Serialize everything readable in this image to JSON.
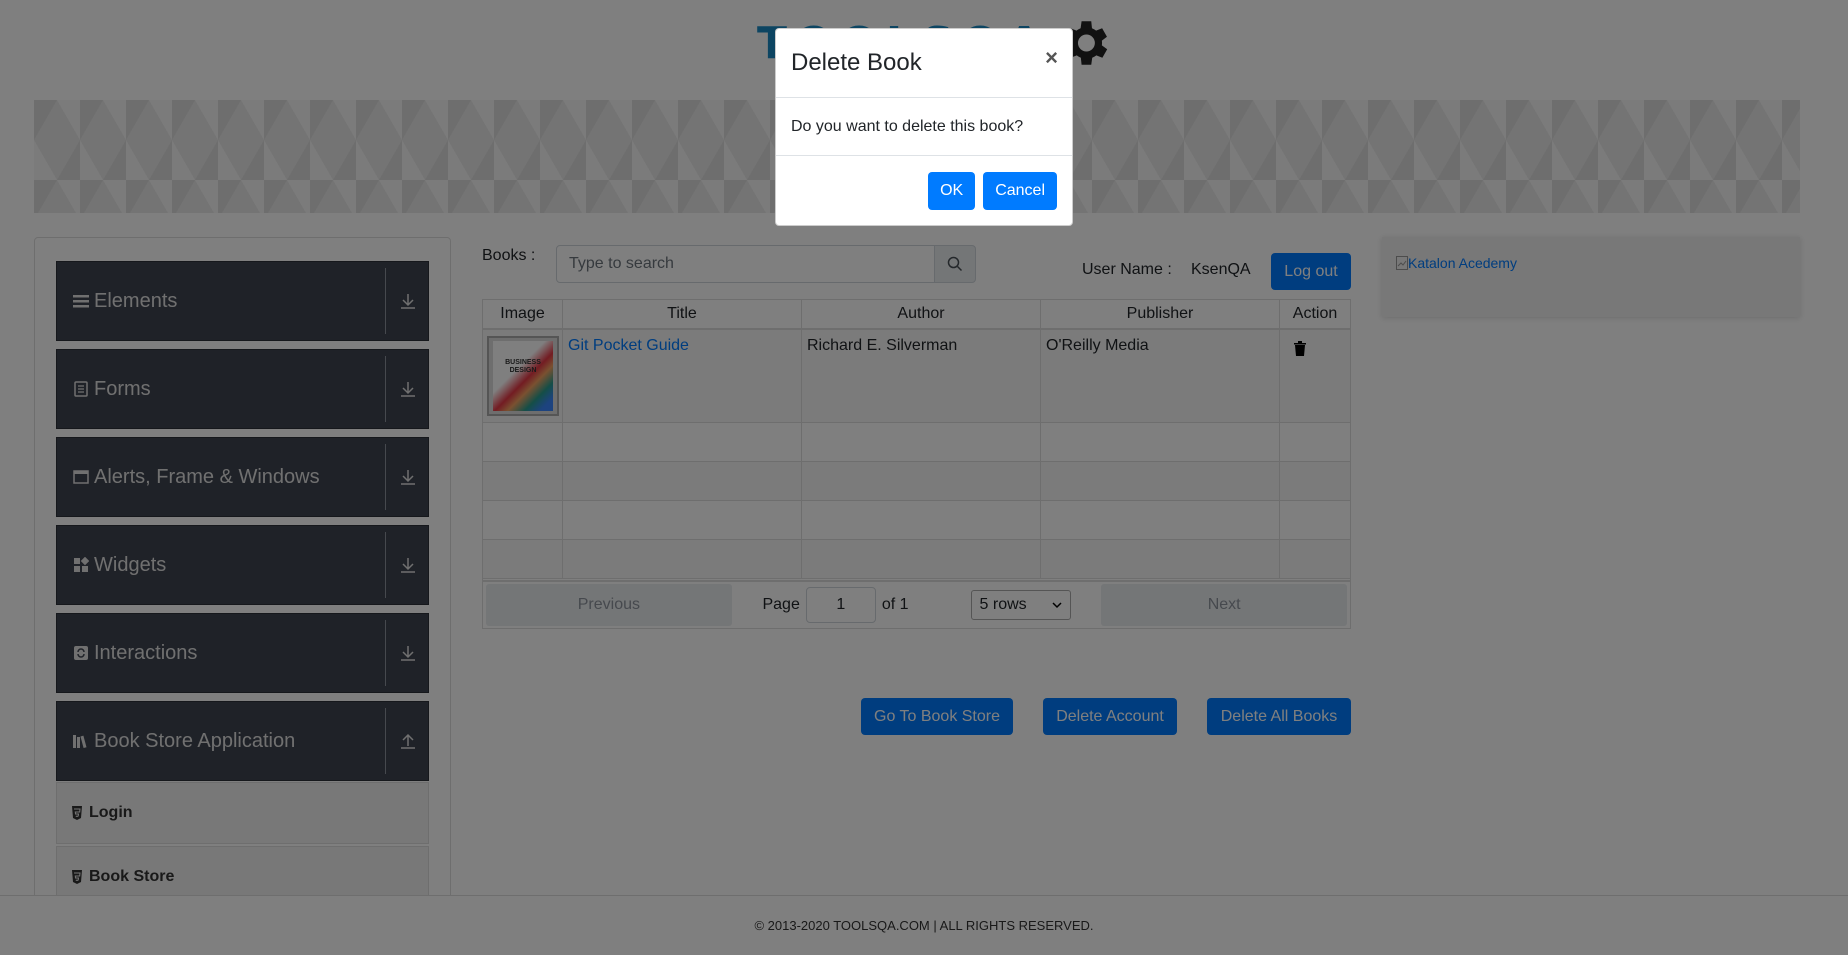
{
  "header": {
    "logo_text": "TOOLSQA"
  },
  "sidebar": {
    "groups": [
      {
        "label": "Elements",
        "icon": "menu-icon"
      },
      {
        "label": "Forms",
        "icon": "form-icon"
      },
      {
        "label": "Alerts, Frame & Windows",
        "icon": "window-icon"
      },
      {
        "label": "Widgets",
        "icon": "widgets-icon"
      },
      {
        "label": "Interactions",
        "icon": "interactions-icon"
      },
      {
        "label": "Book Store Application",
        "icon": "books-icon"
      }
    ],
    "subitems": [
      {
        "label": "Login",
        "icon": "html5-icon"
      },
      {
        "label": "Book Store",
        "icon": "html5-icon"
      }
    ]
  },
  "main": {
    "books_label": "Books :",
    "search": {
      "placeholder": "Type to search"
    },
    "user": {
      "label": "User Name :",
      "value": "KsenQA"
    },
    "logout_label": "Log out",
    "table": {
      "headers": [
        "Image",
        "Title",
        "Author",
        "Publisher",
        "Action"
      ],
      "rows": [
        {
          "cover_text": "BUSINESS DESIGN",
          "title": "Git Pocket Guide",
          "author": "Richard E. Silverman",
          "publisher": "O'Reilly Media"
        }
      ]
    },
    "pagination": {
      "previous": "Previous",
      "page_label": "Page",
      "page_value": "1",
      "of_label": "of 1",
      "rows_select": "5 rows",
      "next": "Next"
    },
    "buttons": {
      "go_to_store": "Go To Book Store",
      "delete_account": "Delete Account",
      "delete_all": "Delete All Books"
    }
  },
  "ad": {
    "alt_text": "Katalon Acedemy"
  },
  "footer": {
    "text": "© 2013-2020 TOOLSQA.COM | ALL RIGHTS RESERVED."
  },
  "modal": {
    "title": "Delete Book",
    "close": "×",
    "body": "Do you want to delete this book?",
    "ok": "OK",
    "cancel": "Cancel"
  },
  "colors": {
    "primary": "#007bff",
    "sidebar": "#3f4551",
    "logo": "#1a8bc5"
  }
}
